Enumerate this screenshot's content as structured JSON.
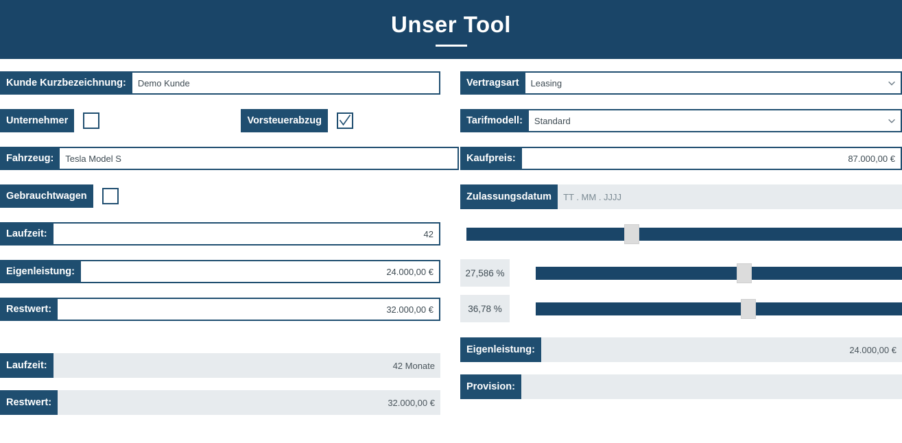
{
  "header": {
    "title": "Unser Tool"
  },
  "left": {
    "kunde": {
      "label": "Kunde Kurzbezeichnung:",
      "value": "Demo Kunde"
    },
    "unternehmer": {
      "label": "Unternehmer",
      "checked": false
    },
    "vorsteuerabzug": {
      "label": "Vorsteuerabzug",
      "checked": true
    },
    "fahrzeug": {
      "label": "Fahrzeug:",
      "value": "Tesla Model S"
    },
    "gebrauchtwagen": {
      "label": "Gebrauchtwagen",
      "checked": false
    },
    "laufzeit": {
      "label": "Laufzeit:",
      "value": "42"
    },
    "eigenleistung": {
      "label": "Eigenleistung:",
      "value": "24.000,00 €"
    },
    "restwert": {
      "label": "Restwert:",
      "value": "32.000,00 €"
    },
    "summary_laufzeit": {
      "label": "Laufzeit:",
      "value": "42 Monate"
    },
    "summary_restwert": {
      "label": "Restwert:",
      "value": "32.000,00 €"
    }
  },
  "right": {
    "vertragsart": {
      "label": "Vertragsart",
      "value": "Leasing",
      "icon": "chevron-down-icon"
    },
    "tarifmodell": {
      "label": "Tarifmodell:",
      "value": "Standard",
      "icon": "chevron-down-icon"
    },
    "kaufpreis": {
      "label": "Kaufpreis:",
      "value": "87.000,00 €"
    },
    "zulassungsdatum": {
      "label": "Zulassungsdatum",
      "placeholder": "TT . MM . JJJJ",
      "value": ""
    },
    "slider_laufzeit": {
      "percent_fill": 38
    },
    "slider_eigenleistung": {
      "label": "27,586 %",
      "percent_fill": 57
    },
    "slider_restwert": {
      "label": "36,78 %",
      "percent_fill": 58
    },
    "summary_eigenleistung": {
      "label": "Eigenleistung:",
      "value": "24.000,00 €"
    },
    "summary_provision": {
      "label": "Provision:",
      "value": ""
    }
  },
  "colors": {
    "brand_dark": "#1a4568",
    "label_blue": "#1f4e70",
    "readonly_gray": "#e7ebee",
    "thumb_gray": "#dcdcdc"
  }
}
